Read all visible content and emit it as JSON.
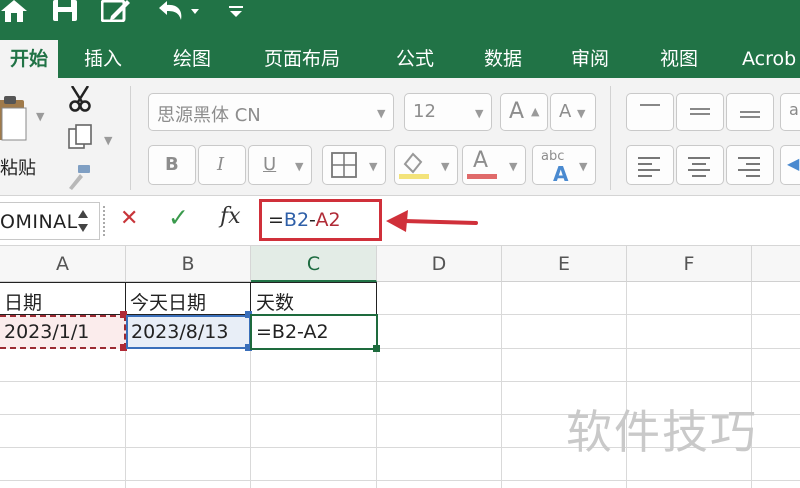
{
  "toolbar": {
    "icons": [
      "home-icon",
      "save-icon",
      "edit-icon",
      "undo-icon",
      "customize-icon"
    ]
  },
  "tabs": [
    "开始",
    "插入",
    "绘图",
    "页面布局",
    "公式",
    "数据",
    "审阅",
    "视图",
    "Acrob"
  ],
  "ribbon": {
    "paste_label": "粘贴",
    "font_name": "思源黑体 CN",
    "font_size": "12",
    "bold": "B",
    "italic": "I",
    "underline": "U",
    "grow_font": "A",
    "shrink_font": "A",
    "font_color": "A",
    "wrap_label": "abc"
  },
  "formula_bar": {
    "name_box": "OMINAL",
    "cancel": "✕",
    "enter": "✓",
    "fx": "fx",
    "formula_eq": "=",
    "formula_ref1": "B2",
    "formula_minus": "-",
    "formula_ref2": "A2"
  },
  "columns": [
    "A",
    "B",
    "C",
    "D",
    "E",
    "F"
  ],
  "rows": [
    [
      "日期",
      "今天日期",
      "天数"
    ],
    [
      "2023/1/1",
      "2023/8/13",
      "=B2-A2"
    ]
  ],
  "watermark": "软件技巧",
  "colors": {
    "excel_green": "#217346",
    "ref1": "#2e5fa8",
    "ref2": "#b02a36",
    "highlight": "#d0303a"
  }
}
